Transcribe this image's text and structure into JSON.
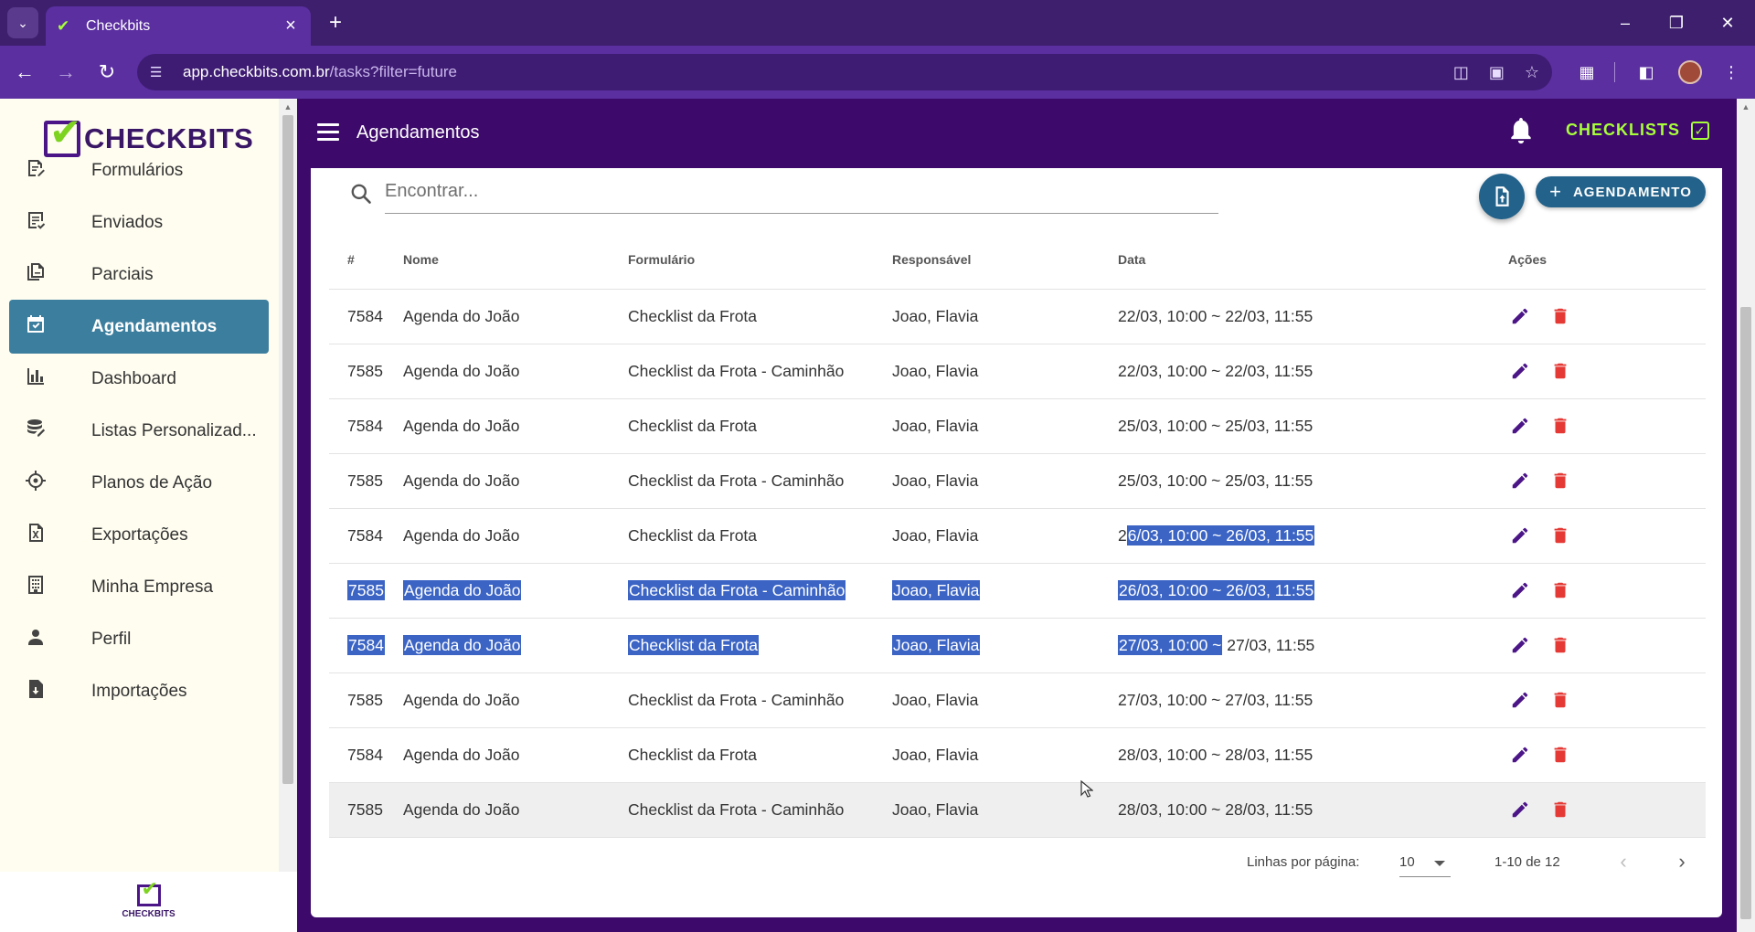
{
  "browser": {
    "tab_title": "Checkbits",
    "url_host": "app.checkbits.com.br",
    "url_path": "/tasks?filter=future"
  },
  "sidebar": {
    "logo_text": "CHECKBITS",
    "footer_logo_text": "CHECKBITS",
    "items": [
      {
        "label": "Formulários",
        "icon": "form-edit-icon"
      },
      {
        "label": "Enviados",
        "icon": "sent-list-icon"
      },
      {
        "label": "Parciais",
        "icon": "partial-docs-icon"
      },
      {
        "label": "Agendamentos",
        "icon": "calendar-check-icon",
        "active": true
      },
      {
        "label": "Dashboard",
        "icon": "bar-chart-icon"
      },
      {
        "label": "Listas Personalizad...",
        "icon": "database-edit-icon"
      },
      {
        "label": "Planos de Ação",
        "icon": "crosshair-icon"
      },
      {
        "label": "Exportações",
        "icon": "excel-file-icon"
      },
      {
        "label": "Minha Empresa",
        "icon": "building-icon"
      },
      {
        "label": "Perfil",
        "icon": "person-icon"
      },
      {
        "label": "Importações",
        "icon": "file-import-icon"
      }
    ]
  },
  "header": {
    "title": "Agendamentos",
    "checklists_label": "CHECKLISTS"
  },
  "search": {
    "placeholder": "Encontrar..."
  },
  "actions": {
    "add_label": "AGENDAMENTO"
  },
  "table": {
    "columns": [
      "#",
      "Nome",
      "Formulário",
      "Responsável",
      "Data",
      "Ações"
    ],
    "rows": [
      {
        "id": "7584",
        "nome": "Agenda do João",
        "formulario": "Checklist da Frota",
        "responsavel": "Joao, Flavia",
        "data": "22/03, 10:00 ~ 22/03, 11:55"
      },
      {
        "id": "7585",
        "nome": "Agenda do João",
        "formulario": "Checklist da Frota - Caminhão",
        "responsavel": "Joao, Flavia",
        "data": "22/03, 10:00 ~ 22/03, 11:55"
      },
      {
        "id": "7584",
        "nome": "Agenda do João",
        "formulario": "Checklist da Frota",
        "responsavel": "Joao, Flavia",
        "data": "25/03, 10:00 ~ 25/03, 11:55"
      },
      {
        "id": "7585",
        "nome": "Agenda do João",
        "formulario": "Checklist da Frota - Caminhão",
        "responsavel": "Joao, Flavia",
        "data": "25/03, 10:00 ~ 25/03, 11:55"
      },
      {
        "id": "7584",
        "nome": "Agenda do João",
        "formulario": "Checklist da Frota",
        "responsavel": "Joao, Flavia",
        "data_a": "2",
        "data_b": "6/03, 10:00 ~ 26/03, 11:55"
      },
      {
        "id": "7585",
        "nome": "Agenda do João",
        "formulario": "Checklist da Frota - Caminhão",
        "responsavel": "Joao, Flavia",
        "data": "26/03, 10:00 ~ 26/03, 11:55"
      },
      {
        "id": "7584",
        "nome": "Agenda do João",
        "formulario": "Checklist da Frota",
        "responsavel": "Joao, Flavia",
        "data_a": "27/03, 10:00 ~",
        "data_b": " 27/03, 11:55"
      },
      {
        "id": "7585",
        "nome": "Agenda do João",
        "formulario": "Checklist da Frota - Caminhão",
        "responsavel": "Joao, Flavia",
        "data": "27/03, 10:00 ~ 27/03, 11:55"
      },
      {
        "id": "7584",
        "nome": "Agenda do João",
        "formulario": "Checklist da Frota",
        "responsavel": "Joao, Flavia",
        "data": "28/03, 10:00 ~ 28/03, 11:55"
      },
      {
        "id": "7585",
        "nome": "Agenda do João",
        "formulario": "Checklist da Frota - Caminhão",
        "responsavel": "Joao, Flavia",
        "data": "28/03, 10:00 ~ 28/03, 11:55"
      }
    ]
  },
  "pagination": {
    "rows_per_page_label": "Linhas por página:",
    "rows_per_page": "10",
    "range": "1-10 de 12"
  },
  "colors": {
    "header_bg": "#3d0a6b",
    "accent_green": "#a7ff3a",
    "active_item": "#3c7e9e",
    "primary_button": "#23628a",
    "edit_icon": "#4b1587",
    "delete_icon": "#e53935",
    "selection": "#3b64c4"
  }
}
